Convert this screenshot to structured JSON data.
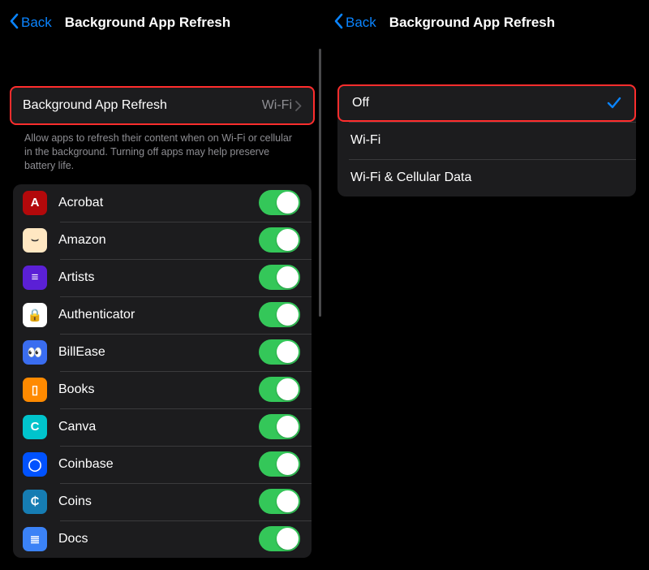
{
  "left": {
    "back_label": "Back",
    "title": "Background App Refresh",
    "setting_row": {
      "label": "Background App Refresh",
      "value": "Wi-Fi"
    },
    "footer": "Allow apps to refresh their content when on Wi-Fi or cellular in the background. Turning off apps may help preserve battery life.",
    "apps": [
      {
        "name": "Acrobat",
        "bg": "#b3090b",
        "glyph": "A"
      },
      {
        "name": "Amazon",
        "bg": "#ffe7c2",
        "glyph": "⌣"
      },
      {
        "name": "Artists",
        "bg": "#5b20d6",
        "glyph": "≡"
      },
      {
        "name": "Authenticator",
        "bg": "#ffffff",
        "glyph": "🔒"
      },
      {
        "name": "BillEase",
        "bg": "#3a6df0",
        "glyph": "👀"
      },
      {
        "name": "Books",
        "bg": "#ff8a00",
        "glyph": "▯"
      },
      {
        "name": "Canva",
        "bg": "#00c4cc",
        "glyph": "C"
      },
      {
        "name": "Coinbase",
        "bg": "#0052ff",
        "glyph": "◯"
      },
      {
        "name": "Coins",
        "bg": "#167db3",
        "glyph": "₵"
      },
      {
        "name": "Docs",
        "bg": "#3b82f6",
        "glyph": "≣"
      }
    ]
  },
  "right": {
    "back_label": "Back",
    "title": "Background App Refresh",
    "options": [
      {
        "label": "Off",
        "selected": true
      },
      {
        "label": "Wi-Fi",
        "selected": false
      },
      {
        "label": "Wi-Fi & Cellular Data",
        "selected": false
      }
    ]
  }
}
